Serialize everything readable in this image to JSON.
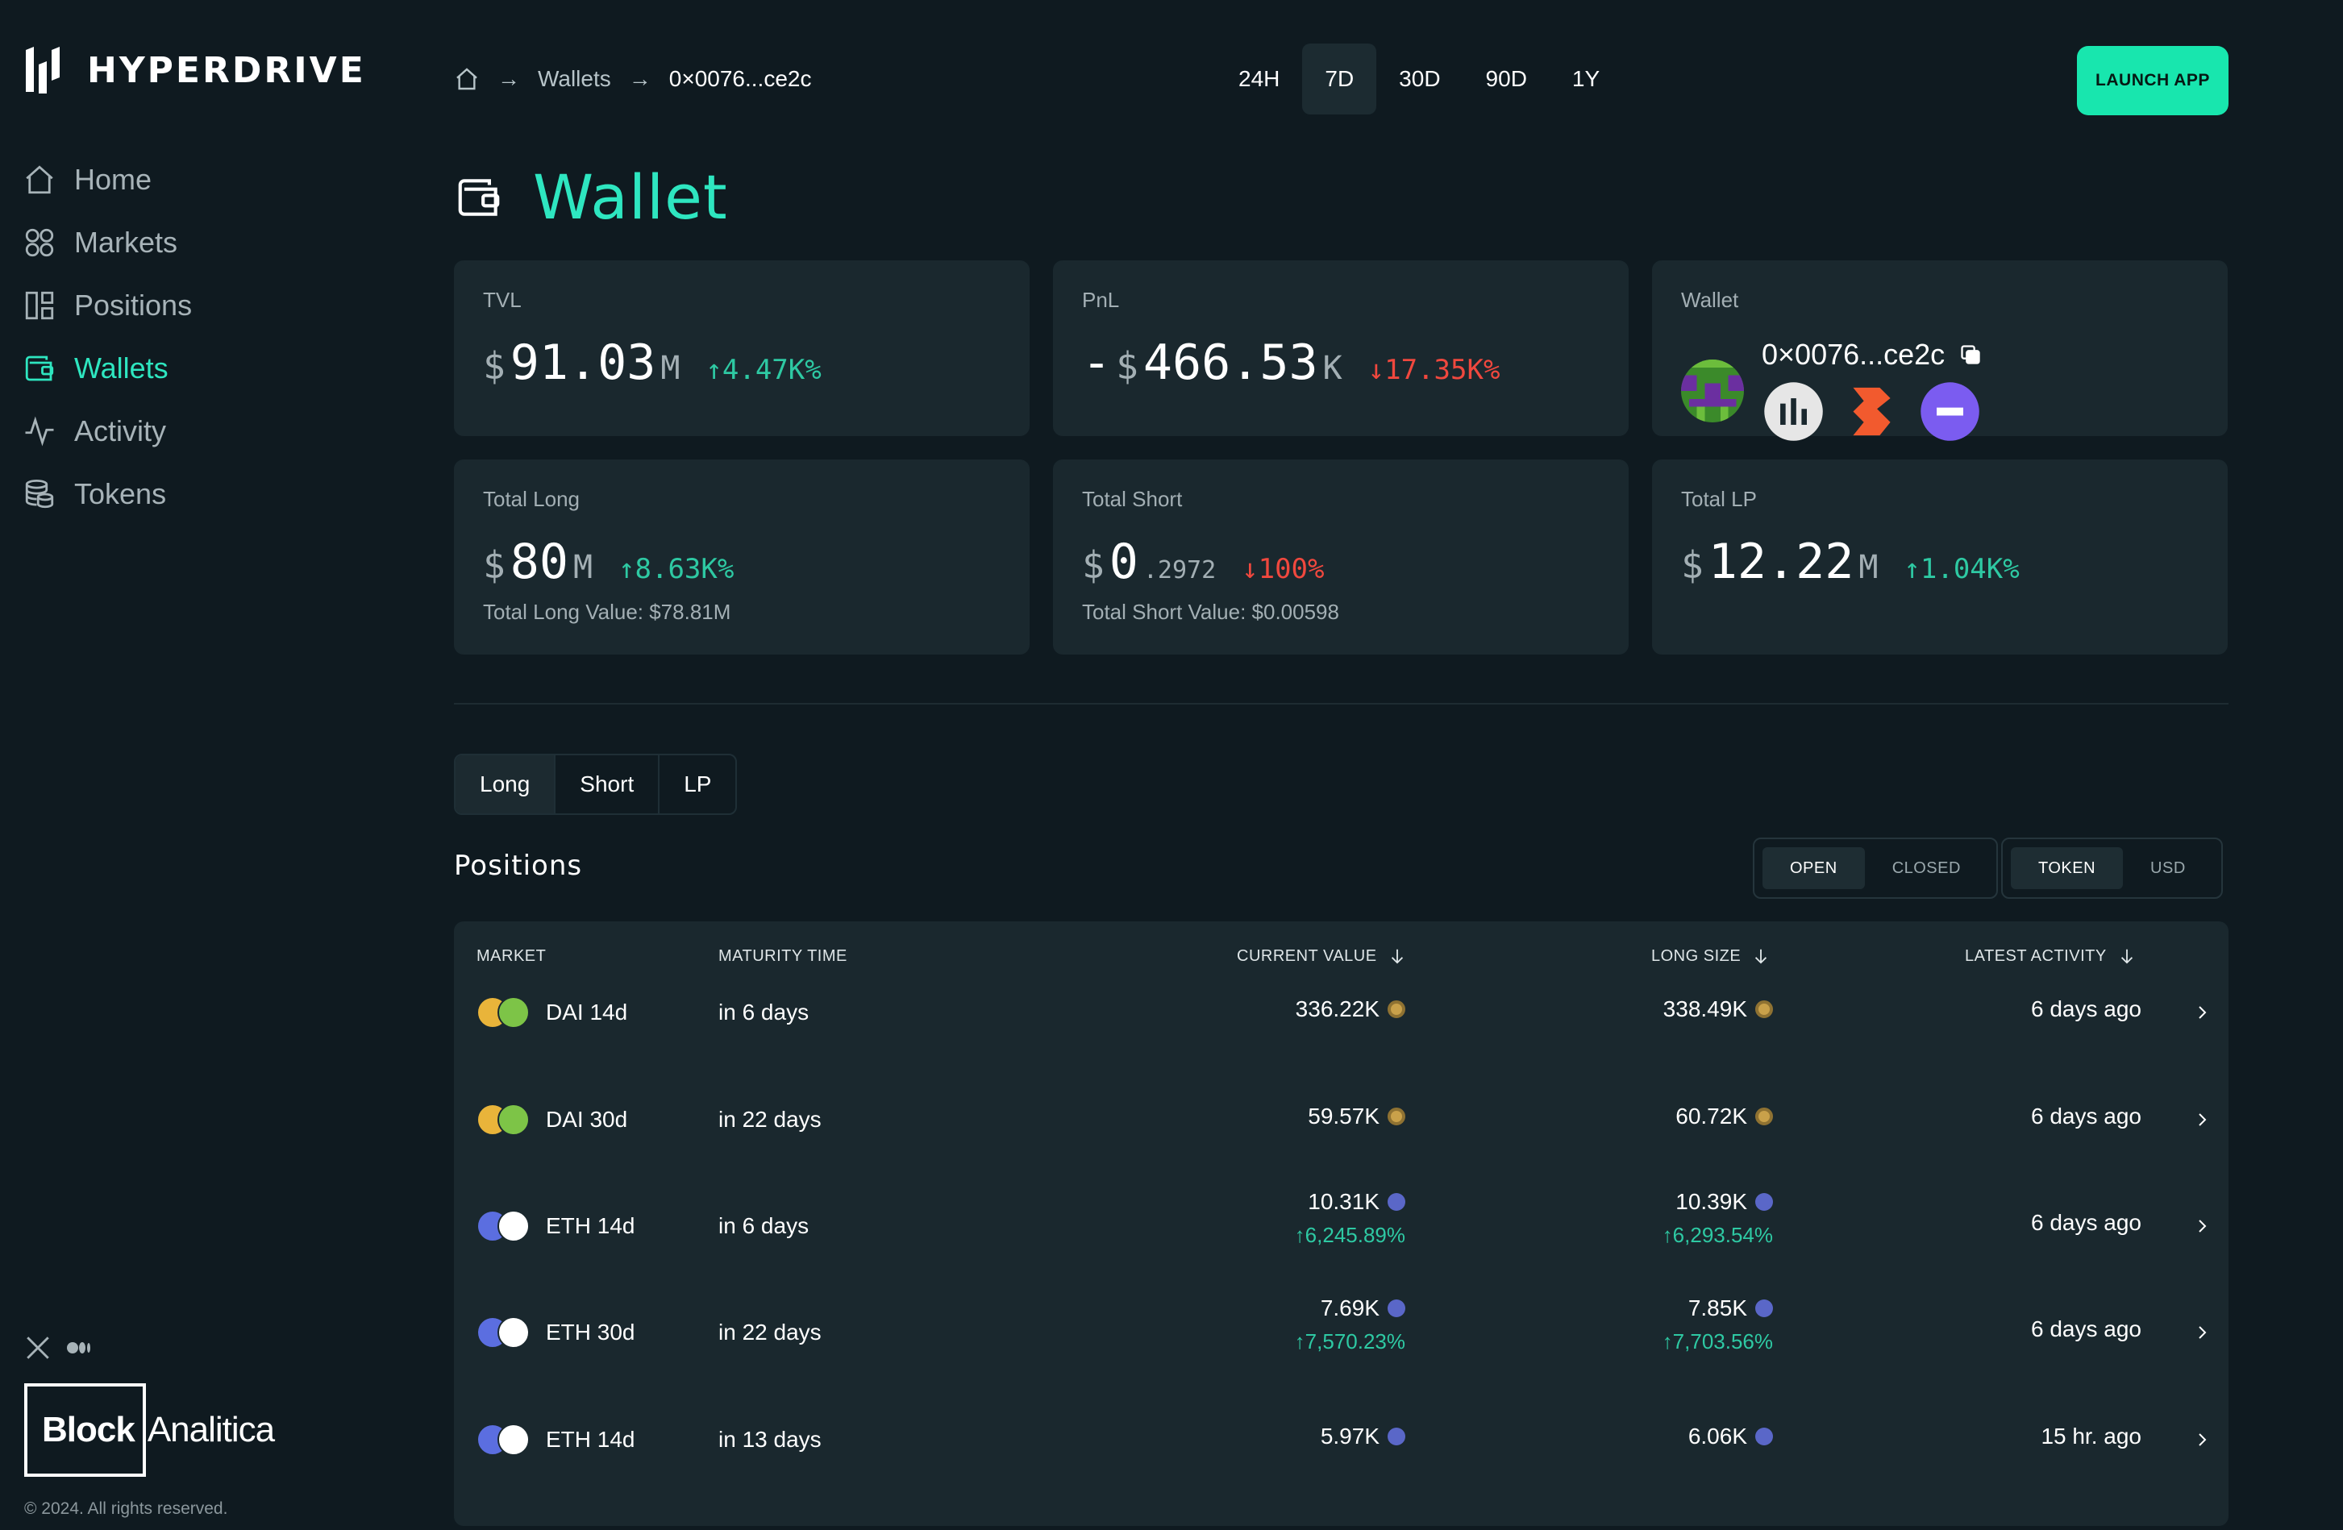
{
  "brand": {
    "name": "HYPERDRIVE"
  },
  "nav": [
    {
      "label": "Home",
      "icon": "home-icon"
    },
    {
      "label": "Markets",
      "icon": "grid-icon"
    },
    {
      "label": "Positions",
      "icon": "layout-icon"
    },
    {
      "label": "Wallets",
      "icon": "wallet-icon",
      "active": true
    },
    {
      "label": "Activity",
      "icon": "activity-icon"
    },
    {
      "label": "Tokens",
      "icon": "coins-icon"
    }
  ],
  "footer": {
    "partner_bold": "Block",
    "partner_light": "Analitica",
    "copyright": "© 2024. All rights reserved."
  },
  "breadcrumb": {
    "parent": "Wallets",
    "current": "0×0076...ce2c"
  },
  "ranges": [
    "24H",
    "7D",
    "30D",
    "90D",
    "1Y"
  ],
  "active_range": "7D",
  "launch_label": "LAUNCH APP",
  "page_title": "Wallet",
  "stats": {
    "tvl": {
      "label": "TVL",
      "currency": "$",
      "value": "91.03",
      "unit": "M",
      "change": "↑4.47K%"
    },
    "pnl": {
      "label": "PnL",
      "sign": "-",
      "currency": "$",
      "value": "466.53",
      "unit": "K",
      "change": "↓17.35K%"
    },
    "wallet": {
      "label": "Wallet",
      "address": "0×0076...ce2c"
    },
    "total_long": {
      "label": "Total Long",
      "currency": "$",
      "value": "80",
      "unit": "M",
      "change": "↑8.63K%",
      "sub": "Total Long Value: $78.81M"
    },
    "total_short": {
      "label": "Total Short",
      "currency": "$",
      "value": "0",
      "decimals": ".2972",
      "change": "↓100%",
      "sub": "Total Short Value: $0.00598"
    },
    "total_lp": {
      "label": "Total LP",
      "currency": "$",
      "value": "12.22",
      "unit": "M",
      "change": "↑1.04K%"
    }
  },
  "position_tabs": [
    "Long",
    "Short",
    "LP"
  ],
  "active_position_tab": "Long",
  "positions_title": "Positions",
  "status_toggle": [
    "OPEN",
    "CLOSED"
  ],
  "unit_toggle": [
    "TOKEN",
    "USD"
  ],
  "table": {
    "headers": {
      "market": "MARKET",
      "maturity": "MATURITY TIME",
      "current_value": "CURRENT VALUE",
      "long_size": "LONG SIZE",
      "latest_activity": "LATEST ACTIVITY"
    },
    "rows": [
      {
        "market": "DAI 14d",
        "maturity": "in 6 days",
        "current_value": "336.22K",
        "current_change": "",
        "long_size": "338.49K",
        "long_change": "",
        "activity": "6 days ago",
        "asset": "dai"
      },
      {
        "market": "DAI 30d",
        "maturity": "in 22 days",
        "current_value": "59.57K",
        "current_change": "",
        "long_size": "60.72K",
        "long_change": "",
        "activity": "6 days ago",
        "asset": "dai"
      },
      {
        "market": "ETH 14d",
        "maturity": "in 6 days",
        "current_value": "10.31K",
        "current_change": "↑6,245.89%",
        "long_size": "10.39K",
        "long_change": "↑6,293.54%",
        "activity": "6 days ago",
        "asset": "eth"
      },
      {
        "market": "ETH 30d",
        "maturity": "in 22 days",
        "current_value": "7.69K",
        "current_change": "↑7,570.23%",
        "long_size": "7.85K",
        "long_change": "↑7,703.56%",
        "activity": "6 days ago",
        "asset": "eth"
      },
      {
        "market": "ETH 14d",
        "maturity": "in 13 days",
        "current_value": "5.97K",
        "current_change": "",
        "long_size": "6.06K",
        "long_change": "",
        "activity": "15 hr. ago",
        "asset": "eth"
      }
    ]
  },
  "colors": {
    "accent": "#2ee6c0",
    "launch": "#18e6ae",
    "up": "#2ec9a3",
    "down": "#f0483e",
    "card": "#1a282e",
    "bg": "#0f1a20"
  }
}
